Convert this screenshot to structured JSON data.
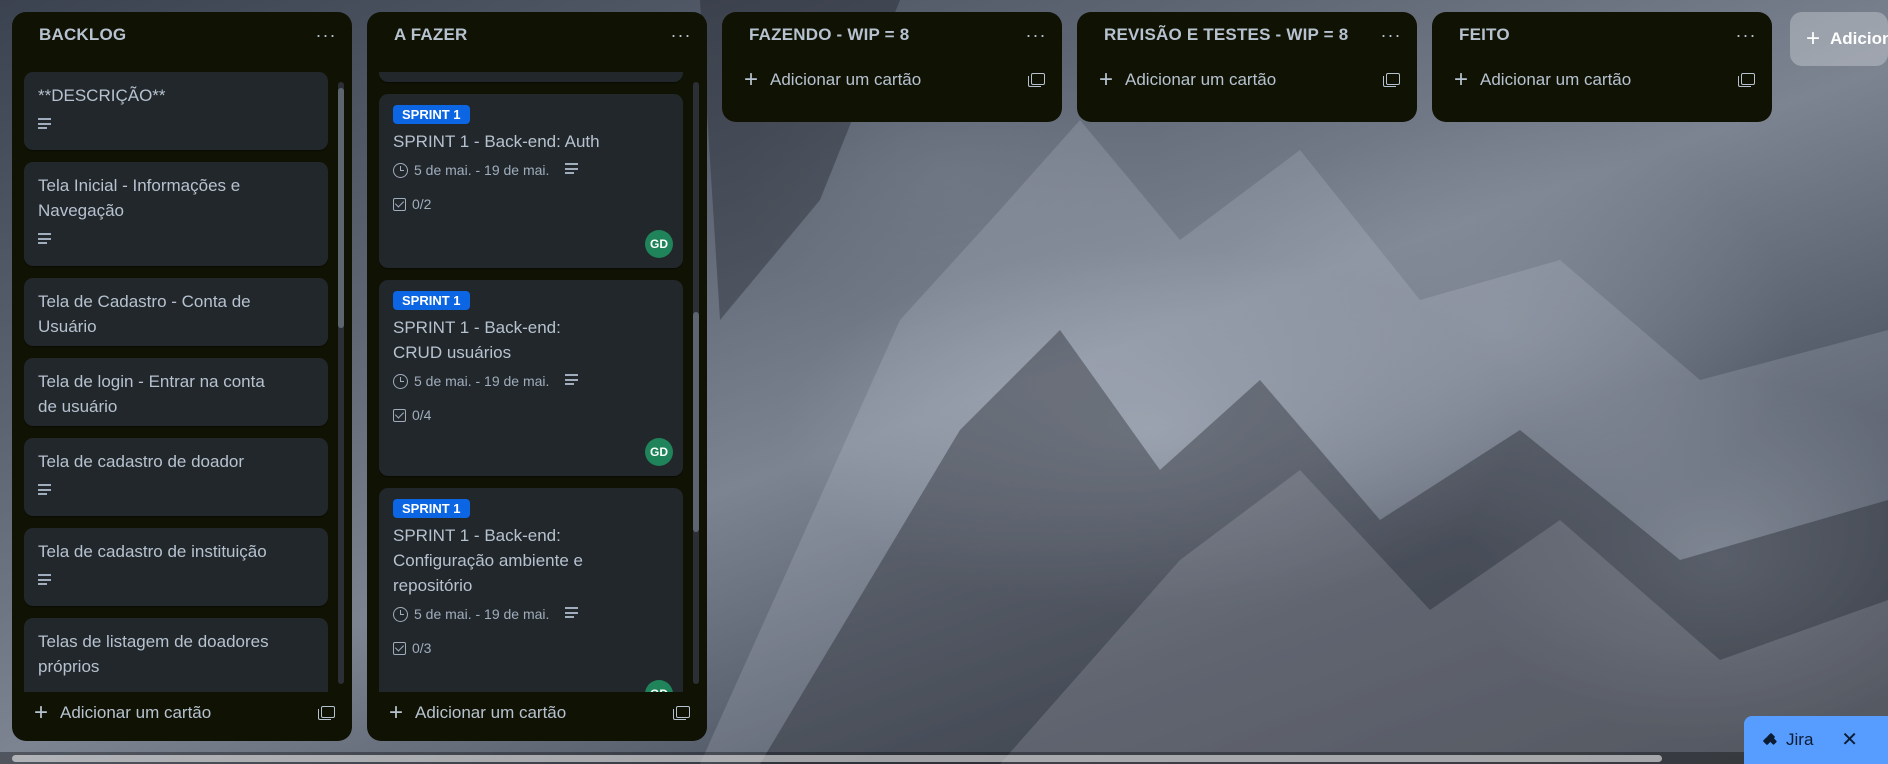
{
  "board": {
    "add_list_label": "Adicionar outra lista",
    "add_card_label": "Adicionar um cartão"
  },
  "lists": [
    {
      "title": "BACKLOG",
      "menu": "···",
      "cards": [
        {
          "title": "**DESCRIÇÃO**",
          "has_description": true
        },
        {
          "title": "Tela Inicial - Informações e Navegação",
          "has_description": true
        },
        {
          "title": "Tela de Cadastro - Conta de Usuário",
          "has_description": false
        },
        {
          "title": "Tela de login - Entrar na conta de usuário",
          "has_description": false
        },
        {
          "title": "Tela de cadastro de doador",
          "has_description": true
        },
        {
          "title": "Tela de cadastro de instituição",
          "has_description": true
        },
        {
          "title": "Telas de listagem de doadores próprios",
          "has_description": false
        }
      ]
    },
    {
      "title": "A FAZER",
      "menu": "···",
      "cards": [
        {
          "label": "SPRINT 1",
          "title": "SPRINT 1 - Back-end: Auth",
          "dates": "5 de mai. - 19 de mai.",
          "checklist": "0/2",
          "member": "GD"
        },
        {
          "label": "SPRINT 1",
          "title": "SPRINT 1 - Back-end: CRUD usuários",
          "dates": "5 de mai. - 19 de mai.",
          "checklist": "0/4",
          "member": "GD"
        },
        {
          "label": "SPRINT 1",
          "title": "SPRINT 1 - Back-end: Configuração ambiente e repositório",
          "dates": "5 de mai. - 19 de mai.",
          "checklist": "0/3",
          "member": "GD"
        }
      ]
    },
    {
      "title": "FAZENDO - WIP = 8",
      "menu": "···",
      "cards": []
    },
    {
      "title": "REVISÃO E TESTES - WIP = 8",
      "menu": "···",
      "cards": []
    },
    {
      "title": "FEITO",
      "menu": "···",
      "cards": []
    }
  ],
  "jira": {
    "label": "Jira",
    "close": "✕"
  },
  "colors": {
    "list_bg": "#101204",
    "card_bg": "#22272b",
    "label_blue": "#0c66e4",
    "avatar_green": "#1f845a",
    "jira_blue": "#579dff"
  }
}
